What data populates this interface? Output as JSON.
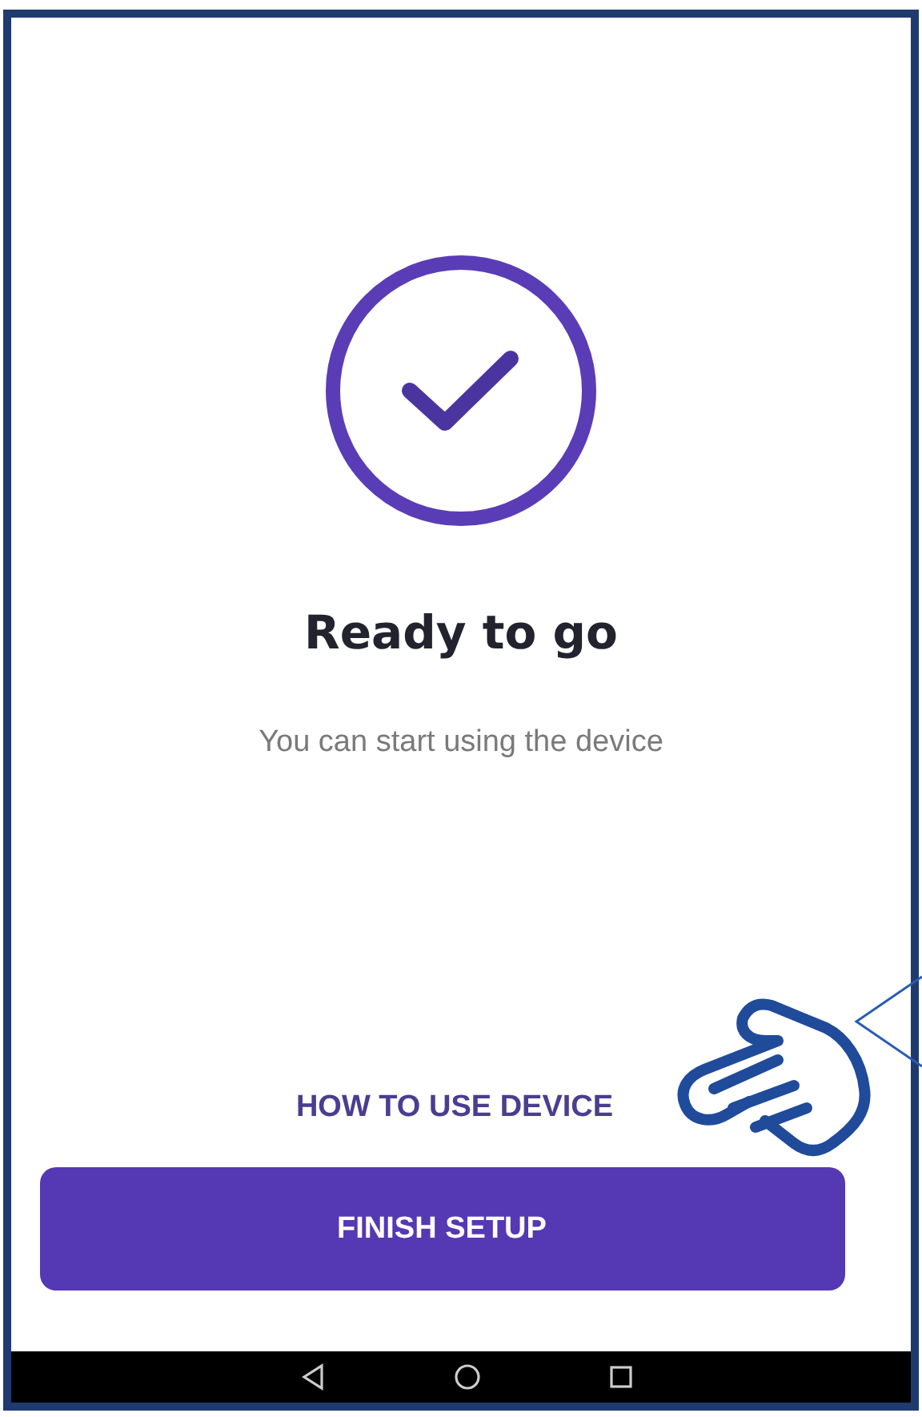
{
  "screen": {
    "title": "Ready to go",
    "subtitle": "You can start using the device"
  },
  "link": {
    "label": "HOW TO USE DEVICE"
  },
  "button": {
    "label": "FINISH SETUP"
  }
}
